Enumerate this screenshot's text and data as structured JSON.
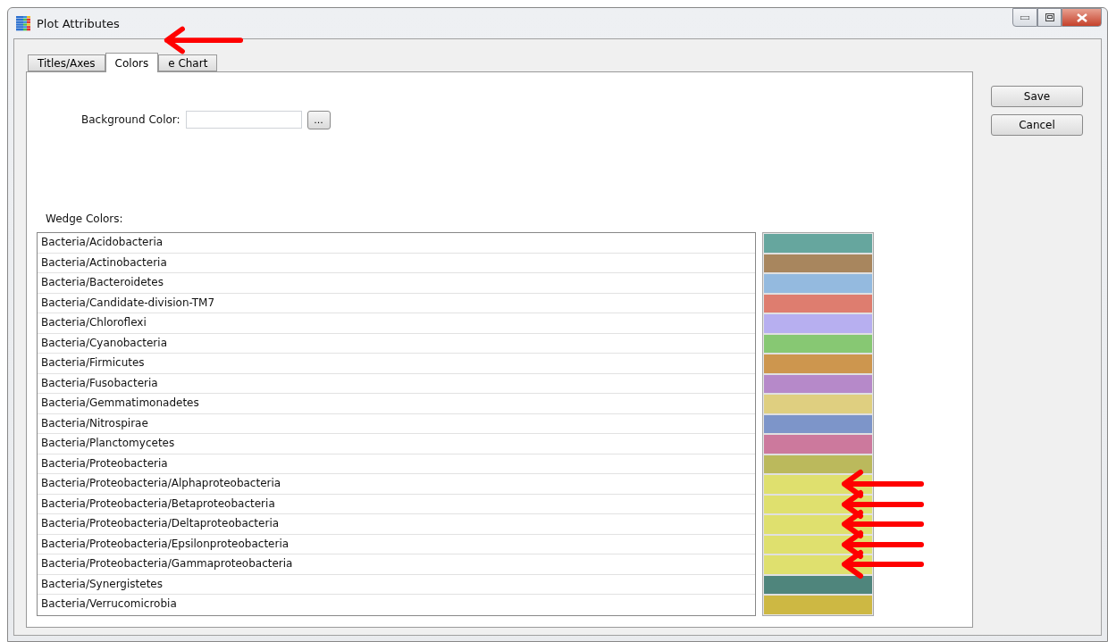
{
  "window": {
    "title": "Plot Attributes"
  },
  "tabs": [
    {
      "label": "Titles/Axes",
      "selected": false
    },
    {
      "label": "Colors",
      "selected": true
    },
    {
      "label": "e Chart",
      "selected": false
    }
  ],
  "background_color": {
    "label": "Background Color:",
    "browse": "..."
  },
  "wedge_colors": {
    "label": "Wedge Colors:",
    "rows": [
      {
        "name": "Bacteria/Acidobacteria",
        "color": "#66a69e"
      },
      {
        "name": "Bacteria/Actinobacteria",
        "color": "#a8865e"
      },
      {
        "name": "Bacteria/Bacteroidetes",
        "color": "#94badf"
      },
      {
        "name": "Bacteria/Candidate-division-TM7",
        "color": "#de7d6f"
      },
      {
        "name": "Bacteria/Chloroflexi",
        "color": "#b7aff0"
      },
      {
        "name": "Bacteria/Cyanobacteria",
        "color": "#87c873"
      },
      {
        "name": "Bacteria/Firmicutes",
        "color": "#cd964e"
      },
      {
        "name": "Bacteria/Fusobacteria",
        "color": "#b689c9"
      },
      {
        "name": "Bacteria/Gemmatimonadetes",
        "color": "#dfcf80"
      },
      {
        "name": "Bacteria/Nitrospirae",
        "color": "#7d95c9"
      },
      {
        "name": "Bacteria/Planctomycetes",
        "color": "#cc799d"
      },
      {
        "name": "Bacteria/Proteobacteria",
        "color": "#bbb95c"
      },
      {
        "name": "Bacteria/Proteobacteria/Alphaproteobacteria",
        "color": "#dfe06e"
      },
      {
        "name": "Bacteria/Proteobacteria/Betaproteobacteria",
        "color": "#dfe06e"
      },
      {
        "name": "Bacteria/Proteobacteria/Deltaproteobacteria",
        "color": "#dfe06e"
      },
      {
        "name": "Bacteria/Proteobacteria/Epsilonproteobacteria",
        "color": "#dfe06e"
      },
      {
        "name": "Bacteria/Proteobacteria/Gammaproteobacteria",
        "color": "#dfe06e"
      },
      {
        "name": "Bacteria/Synergistetes",
        "color": "#4f857c"
      },
      {
        "name": "Bacteria/Verrucomicrobia",
        "color": "#cdb843"
      }
    ]
  },
  "buttons": [
    "Save",
    "Cancel"
  ]
}
